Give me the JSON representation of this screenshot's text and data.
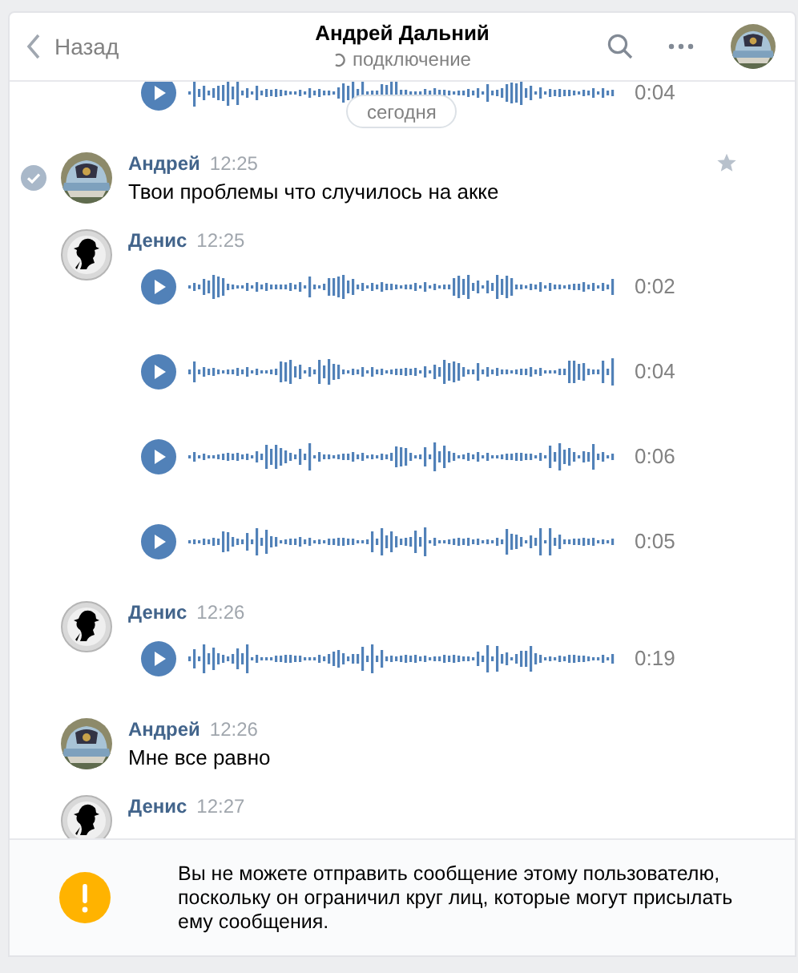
{
  "header": {
    "back": "Назад",
    "title": "Андрей Дальний",
    "status": "подключение"
  },
  "date_badge": "сегодня",
  "groups": [
    {
      "items": [
        {
          "kind": "voice",
          "duration": "0:04"
        }
      ]
    },
    {
      "author": "Андрей",
      "time": "12:25",
      "hovered": true,
      "items": [
        {
          "kind": "text",
          "text": "Твои проблемы что случилось на акке"
        }
      ]
    },
    {
      "author": "Денис",
      "time": "12:25",
      "avatar": {
        "kind": "silhouette"
      },
      "hovered": false,
      "items": [
        {
          "kind": "voice",
          "duration": "0:02"
        },
        {
          "kind": "voice",
          "duration": "0:04"
        },
        {
          "kind": "voice",
          "duration": "0:06"
        },
        {
          "kind": "voice",
          "duration": "0:05"
        }
      ]
    },
    {
      "author": "Денис",
      "time": "12:26",
      "avatar": {
        "kind": "silhouette"
      },
      "hovered": false,
      "items": [
        {
          "kind": "voice",
          "duration": "0:19"
        }
      ]
    },
    {
      "author": "Андрей",
      "time": "12:26",
      "hovered": false,
      "items": [
        {
          "kind": "text",
          "text": "Мне все равно"
        }
      ]
    },
    {
      "author": "Денис",
      "time": "12:27",
      "avatar": {
        "kind": "silhouette"
      },
      "hovered": false
    }
  ],
  "notice": {
    "text": "Вы не можете отправить сообщение этому пользователю, поскольку он ограничил круг лиц, которые могут присылать ему сообщения."
  }
}
